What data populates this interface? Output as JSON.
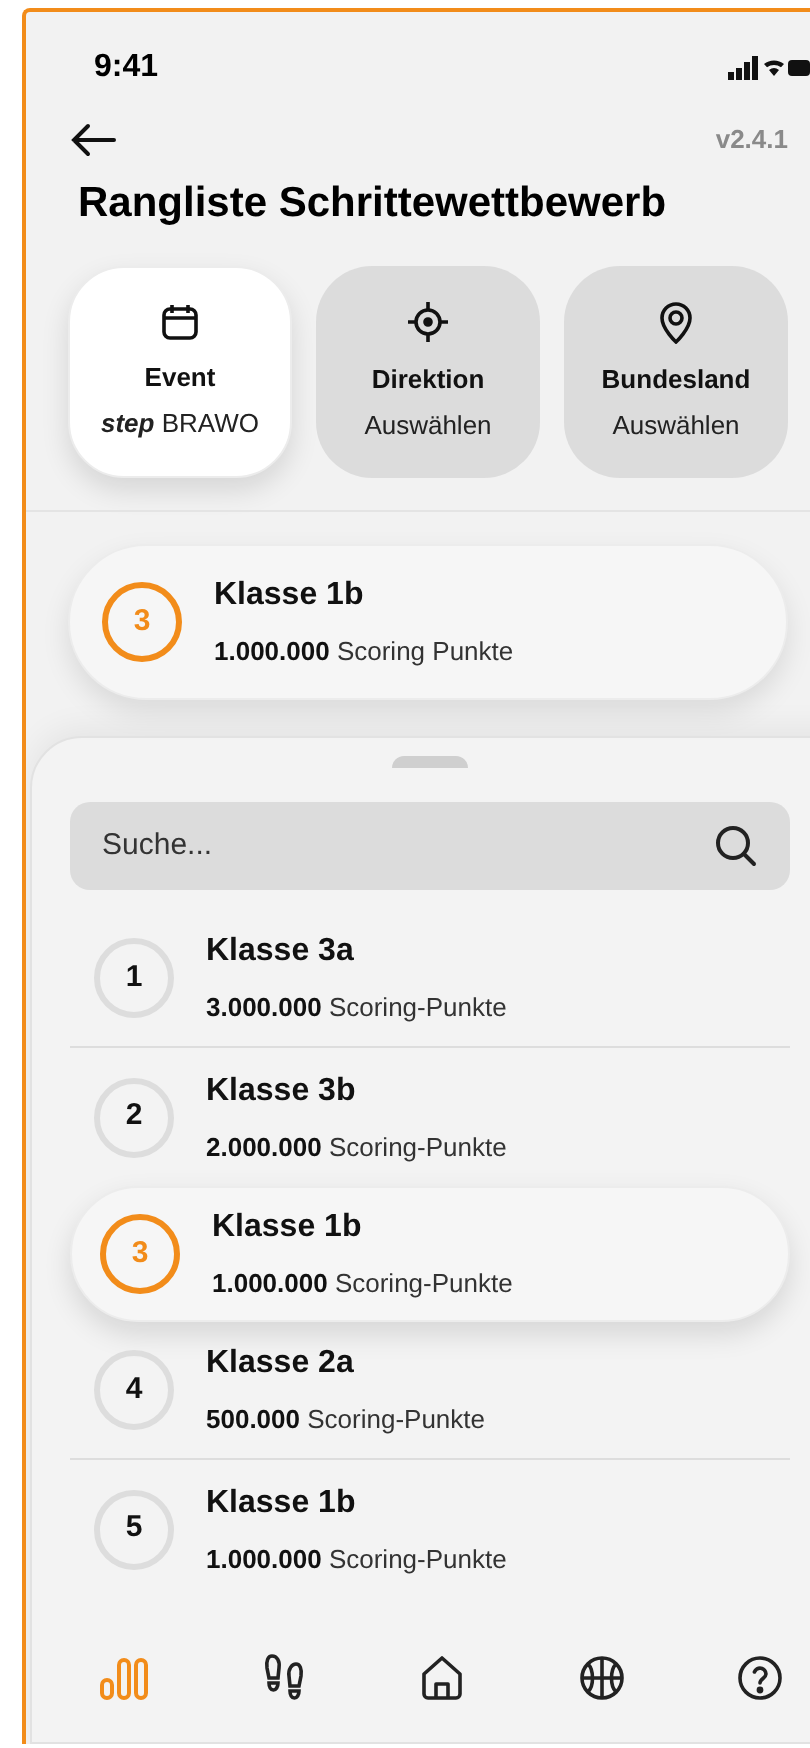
{
  "status_bar": {
    "time": "9:41"
  },
  "header": {
    "version": "v2.4.1",
    "title": "Rangliste Schrittewettbewerb"
  },
  "filters": [
    {
      "kind": "event",
      "label": "Event",
      "value": "**step** BRAWO",
      "selected": true
    },
    {
      "kind": "target",
      "label": "Direktion",
      "value": "Auswählen",
      "selected": false
    },
    {
      "kind": "pin",
      "label": "Bundesland",
      "value": "Auswählen",
      "selected": false
    }
  ],
  "own_rank": {
    "rank": "3",
    "name": "Klasse 1b",
    "points": "**1.000.000** Scoring Punkte"
  },
  "search": {
    "placeholder": "Suche..."
  },
  "ranking": [
    {
      "rank": "1",
      "name": "Klasse 3a",
      "points": "**3.000.000** Scoring-Punkte",
      "selected": false
    },
    {
      "rank": "2",
      "name": "Klasse 3b",
      "points": "**2.000.000** Scoring-Punkte",
      "selected": false
    },
    {
      "rank": "3",
      "name": "Klasse 1b",
      "points": "**1.000.000** Scoring-Punkte",
      "selected": true
    },
    {
      "rank": "4",
      "name": "Klasse 2a",
      "points": "**500.000** Scoring-Punkte",
      "selected": false
    },
    {
      "rank": "5",
      "name": "Klasse 1b",
      "points": "**1.000.000** Scoring-Punkte",
      "selected": false
    }
  ],
  "nav": [
    {
      "kind": "ranking",
      "selected": true
    },
    {
      "kind": "steps",
      "selected": false
    },
    {
      "kind": "home",
      "selected": false
    },
    {
      "kind": "sport",
      "selected": false
    },
    {
      "kind": "help",
      "selected": false
    }
  ]
}
